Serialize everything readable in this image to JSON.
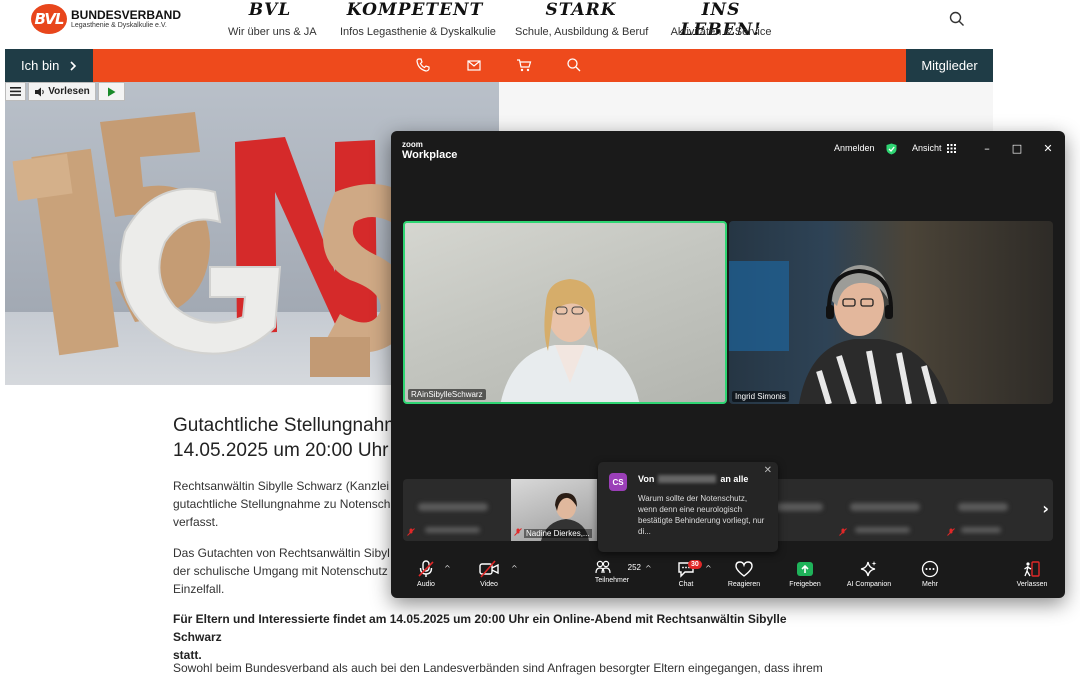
{
  "site": {
    "logo": {
      "mark": "BVL",
      "title": "BUNDESVERBAND",
      "subtitle": "Legasthenie & Dyskalkulie e.V."
    },
    "nav": [
      {
        "big": "BVL",
        "small": "Wir über uns & JA"
      },
      {
        "big": "KOMPETENT",
        "small": "Infos Legasthenie & Dyskalkulie"
      },
      {
        "big": "STARK",
        "small": "Schule, Ausbildung & Beruf"
      },
      {
        "big": "INS LEBEN!",
        "small": "Aktivitäten & Service"
      }
    ],
    "ichbin": "Ich bin",
    "mitglieder": "Mitglieder",
    "vorlesen": "Vorlesen",
    "hero_digits": "15"
  },
  "article": {
    "title_line1": "Gutachtliche Stellungnahme",
    "title_line2": "14.05.2025 um 20:00 Uhr",
    "p1": [
      "Rechtsanwältin Sibylle Schwarz (Kanzlei",
      "gutachtliche Stellungnahme zu Notensch",
      "verfasst."
    ],
    "p2": [
      "Das Gutachten von Rechtsanwältin Sibyl",
      "der schulische Umgang mit Notenschutz",
      "Einzelfall."
    ],
    "bold": [
      "Für Eltern und Interessierte findet am 14.05.2025 um 20:00 Uhr ein Online-Abend mit Rechtsanwältin Sibylle Schwarz",
      "statt."
    ],
    "p3": "Sowohl beim Bundesverband als auch bei den Landesverbänden sind Anfragen besorgter Eltern eingegangen, dass ihrem"
  },
  "zoom": {
    "brand_top": "zoom",
    "brand_bottom": "Workplace",
    "anmelden": "Anmelden",
    "ansicht": "Ansicht",
    "speakers": [
      {
        "name": "RAinSibylleSchwarz"
      },
      {
        "name": "Ingrid Simonis"
      }
    ],
    "strip_visible_name": "Nadine Dierkes,...",
    "chat": {
      "avatar": "CS",
      "from_prefix": "Von",
      "from_suffix": "an alle",
      "message": "Warum sollte der Notenschutz, wenn denn eine neurologisch bestätigte Behinderung vorliegt, nur di..."
    },
    "toolbar": {
      "audio": "Audio",
      "video": "Video",
      "participants": "Teilnehmer",
      "participant_count": "252",
      "chat": "Chat",
      "chat_badge": "30",
      "reactions": "Reagieren",
      "share": "Freigeben",
      "ai": "AI Companion",
      "more": "Mehr",
      "leave": "Verlassen"
    },
    "colors": {
      "active_speaker": "#2fd573",
      "share": "#1fb35a",
      "alert": "#e02828"
    }
  }
}
